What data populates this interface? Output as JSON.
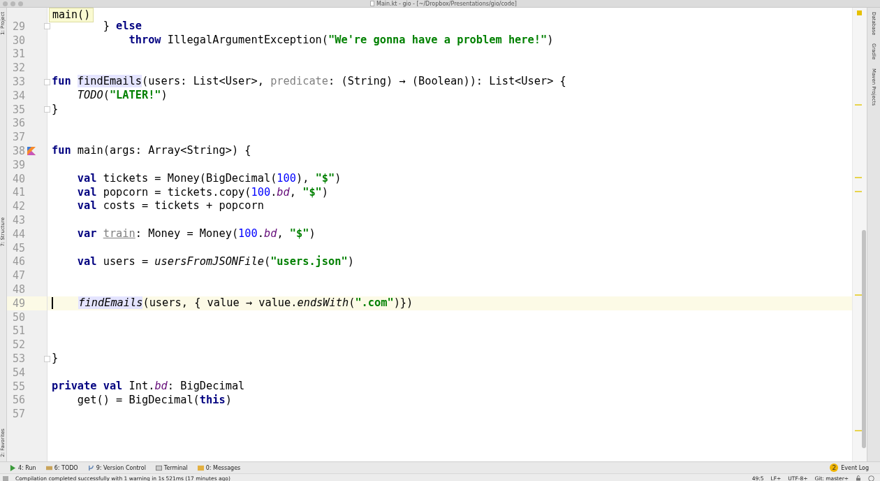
{
  "window": {
    "title": "Main.kt - gio - [~/Dropbox/Presentations/gio/code]"
  },
  "breadcrumb": "main()",
  "left_tool_windows": [
    "1: Project",
    "7: Structure",
    "2: Favorites"
  ],
  "right_tool_windows": [
    "Database",
    "Gradle",
    "Maven Projects"
  ],
  "lines": [
    {
      "number": "29",
      "current": false,
      "run_icon": false,
      "fold": true,
      "segments": [
        {
          "kind": "text",
          "text": "        } "
        },
        {
          "kind": "kw",
          "text": "else"
        }
      ]
    },
    {
      "number": "30",
      "current": false,
      "run_icon": false,
      "fold": false,
      "segments": [
        {
          "kind": "kw",
          "text": "            throw"
        },
        {
          "kind": "text",
          "text": " IllegalArgumentException("
        },
        {
          "kind": "str",
          "text": "\"We're gonna have a problem here!\""
        },
        {
          "kind": "text",
          "text": ")"
        }
      ]
    },
    {
      "number": "31",
      "current": false,
      "run_icon": false,
      "fold": false
    },
    {
      "number": "32",
      "current": false,
      "run_icon": false,
      "fold": false
    },
    {
      "number": "33",
      "current": false,
      "run_icon": false,
      "fold": true,
      "segments": [
        {
          "kind": "kw",
          "text": "fun "
        },
        {
          "kind": "hl",
          "text": "findEmails"
        },
        {
          "kind": "text",
          "text": "(users: List<User>, "
        },
        {
          "kind": "param",
          "text": "predicate"
        },
        {
          "kind": "text",
          "text": ": (String) → (Boolean)): List<User> {"
        }
      ]
    },
    {
      "number": "34",
      "current": false,
      "run_icon": false,
      "fold": false,
      "segments": [
        {
          "kind": "italic",
          "text": "    TODO"
        },
        {
          "kind": "text",
          "text": "("
        },
        {
          "kind": "str",
          "text": "\"LATER!\""
        },
        {
          "kind": "text",
          "text": ")"
        }
      ]
    },
    {
      "number": "35",
      "current": false,
      "run_icon": false,
      "fold": true,
      "segments": [
        {
          "kind": "text",
          "text": "}"
        }
      ]
    },
    {
      "number": "36",
      "current": false,
      "run_icon": false,
      "fold": false
    },
    {
      "number": "37",
      "current": false,
      "run_icon": false,
      "fold": false
    },
    {
      "number": "38",
      "current": false,
      "run_icon": true,
      "fold": false,
      "segments": [
        {
          "kind": "kw",
          "text": "fun"
        },
        {
          "kind": "text",
          "text": " main(args: Array<String>) {"
        }
      ]
    },
    {
      "number": "39",
      "current": false,
      "run_icon": false,
      "fold": false
    },
    {
      "number": "40",
      "current": false,
      "run_icon": false,
      "fold": false,
      "segments": [
        {
          "kind": "kw",
          "text": "    val"
        },
        {
          "kind": "text",
          "text": " tickets = Money(BigDecimal("
        },
        {
          "kind": "num",
          "text": "100"
        },
        {
          "kind": "text",
          "text": "), "
        },
        {
          "kind": "str",
          "text": "\"$\""
        },
        {
          "kind": "text",
          "text": ")"
        }
      ]
    },
    {
      "number": "41",
      "current": false,
      "run_icon": false,
      "fold": false,
      "segments": [
        {
          "kind": "kw",
          "text": "    val"
        },
        {
          "kind": "text",
          "text": " popcorn = tickets.copy("
        },
        {
          "kind": "num",
          "text": "100"
        },
        {
          "kind": "text",
          "text": "."
        },
        {
          "kind": "ext",
          "text": "bd"
        },
        {
          "kind": "text",
          "text": ", "
        },
        {
          "kind": "str",
          "text": "\"$\""
        },
        {
          "kind": "text",
          "text": ")"
        }
      ]
    },
    {
      "number": "42",
      "current": false,
      "run_icon": false,
      "fold": false,
      "segments": [
        {
          "kind": "kw",
          "text": "    val"
        },
        {
          "kind": "text",
          "text": " costs = tickets + popcorn"
        }
      ]
    },
    {
      "number": "43",
      "current": false,
      "run_icon": false,
      "fold": false
    },
    {
      "number": "44",
      "current": false,
      "run_icon": false,
      "fold": false,
      "segments": [
        {
          "kind": "kw",
          "text": "    var "
        },
        {
          "kind": "unused",
          "text": "train"
        },
        {
          "kind": "text",
          "text": ": Money = Money("
        },
        {
          "kind": "num",
          "text": "100"
        },
        {
          "kind": "text",
          "text": "."
        },
        {
          "kind": "ext",
          "text": "bd"
        },
        {
          "kind": "text",
          "text": ", "
        },
        {
          "kind": "str",
          "text": "\"$\""
        },
        {
          "kind": "text",
          "text": ")"
        }
      ]
    },
    {
      "number": "45",
      "current": false,
      "run_icon": false,
      "fold": false
    },
    {
      "number": "46",
      "current": false,
      "run_icon": false,
      "fold": false,
      "segments": [
        {
          "kind": "kw",
          "text": "    val"
        },
        {
          "kind": "text",
          "text": " users = "
        },
        {
          "kind": "italic",
          "text": "usersFromJSONFile"
        },
        {
          "kind": "text",
          "text": "("
        },
        {
          "kind": "str",
          "text": "\"users.json\""
        },
        {
          "kind": "text",
          "text": ")"
        }
      ]
    },
    {
      "number": "47",
      "current": false,
      "run_icon": false,
      "fold": false
    },
    {
      "number": "48",
      "current": false,
      "run_icon": false,
      "fold": false
    },
    {
      "number": "49",
      "current": true,
      "run_icon": false,
      "fold": false,
      "segments": [
        {
          "kind": "hl-italic",
          "text": "findEmails"
        },
        {
          "kind": "text",
          "text": "(users, { value → value."
        },
        {
          "kind": "italic",
          "text": "endsWith"
        },
        {
          "kind": "text",
          "text": "("
        },
        {
          "kind": "str",
          "text": "\".com\""
        },
        {
          "kind": "text",
          "text": ")})"
        }
      ]
    },
    {
      "number": "50",
      "current": false,
      "run_icon": false,
      "fold": false
    },
    {
      "number": "51",
      "current": false,
      "run_icon": false,
      "fold": false
    },
    {
      "number": "52",
      "current": false,
      "run_icon": false,
      "fold": false
    },
    {
      "number": "53",
      "current": false,
      "run_icon": false,
      "fold": true,
      "segments": [
        {
          "kind": "text",
          "text": "}"
        }
      ]
    },
    {
      "number": "54",
      "current": false,
      "run_icon": false,
      "fold": false
    },
    {
      "number": "55",
      "current": false,
      "run_icon": false,
      "fold": false,
      "segments": [
        {
          "kind": "kw",
          "text": "private val"
        },
        {
          "kind": "text",
          "text": " Int."
        },
        {
          "kind": "ext",
          "text": "bd"
        },
        {
          "kind": "text",
          "text": ": BigDecimal"
        }
      ]
    },
    {
      "number": "56",
      "current": false,
      "run_icon": false,
      "fold": false,
      "segments": [
        {
          "kind": "text",
          "text": "    get() = BigDecimal("
        },
        {
          "kind": "kw",
          "text": "this"
        },
        {
          "kind": "text",
          "text": ")"
        }
      ]
    },
    {
      "number": "57",
      "current": false,
      "run_icon": false,
      "fold": false
    }
  ],
  "tool_tabs": [
    {
      "kind": "run",
      "label": "4: Run"
    },
    {
      "kind": "todo",
      "label": "6: TODO"
    },
    {
      "kind": "vcs",
      "label": "9: Version Control"
    },
    {
      "kind": "terminal",
      "label": "Terminal"
    },
    {
      "kind": "messages",
      "label": "0: Messages"
    }
  ],
  "event_log": {
    "count": "2",
    "label": "Event Log"
  },
  "status_bar": {
    "message": "Compilation completed successfully with 1 warning in 1s 521ms (17 minutes ago)",
    "position": "49:5",
    "line_separator": "LF÷",
    "encoding": "UTF-8÷",
    "vcs": "Git: master÷"
  }
}
